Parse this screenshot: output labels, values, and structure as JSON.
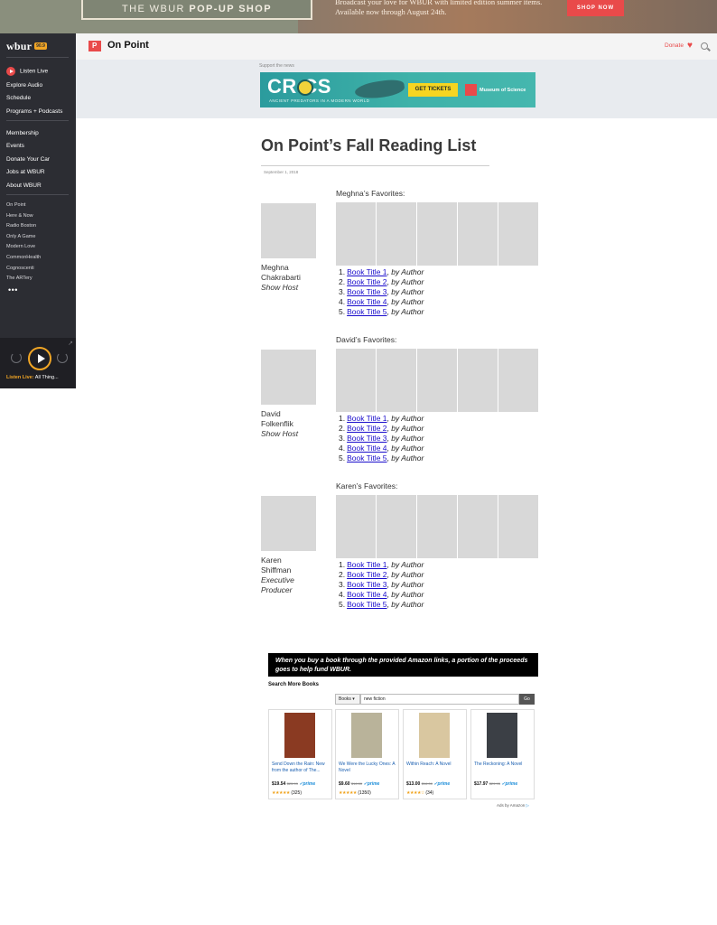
{
  "promo": {
    "shop_prefix": "THE WBUR",
    "shop_bold": "POP-UP SHOP",
    "copy": "Broadcast your love for WBUR with limited edition summer items. Available now through August 24th.",
    "button": "SHOP NOW"
  },
  "sidebar": {
    "logo": "wbur",
    "logo_badge": "90.9",
    "listen": "Listen Live",
    "main_items": [
      "Explore Audio",
      "Schedule",
      "Programs + Podcasts"
    ],
    "secondary_items": [
      "Membership",
      "Events",
      "Donate Your Car",
      "Jobs at WBUR",
      "About WBUR"
    ],
    "programs": [
      "On Point",
      "Here & Now",
      "Radio Boston",
      "Only A Game",
      "Modern Love",
      "CommonHealth",
      "Cognoscenti",
      "The ARTery"
    ],
    "more": "•••",
    "player_label_key": "Listen Live:",
    "player_label_val": "All Thing..."
  },
  "header": {
    "program": "On Point",
    "donate": "Donate",
    "heart": "♥"
  },
  "ad": {
    "support": "Support the news",
    "headline": "CR  CS",
    "tagline": "ANCIENT PREDATORS IN A MODERN WORLD",
    "button": "GET TICKETS",
    "sponsor": "Museum of Science"
  },
  "article": {
    "title": "On Point’s Fall Reading List",
    "date": "September 1, 2018"
  },
  "favorites": [
    {
      "label": "Meghna’s Favorites:",
      "name_line1": "Meghna",
      "name_line2": "Chakrabarti",
      "role_line1": "Show Host",
      "role_line2": "",
      "books": [
        {
          "num": "1.",
          "title": "Book Title 1",
          "author": "by Author"
        },
        {
          "num": "2.",
          "title": "Book Title 2",
          "author": "by Author"
        },
        {
          "num": "3.",
          "title": "Book Title 3",
          "author": "by Author"
        },
        {
          "num": "4.",
          "title": "Book Title 4",
          "author": "by Author"
        },
        {
          "num": "5.",
          "title": "Book Title 5",
          "author": "by Author"
        }
      ]
    },
    {
      "label": "David’s Favorites:",
      "name_line1": "David",
      "name_line2": "Folkenflik",
      "role_line1": "Show Host",
      "role_line2": "",
      "books": [
        {
          "num": "1.",
          "title": "Book Title 1",
          "author": "by Author"
        },
        {
          "num": "2.",
          "title": "Book Title 2",
          "author": "by Author"
        },
        {
          "num": "3.",
          "title": "Book Title 3",
          "author": "by Author"
        },
        {
          "num": "4.",
          "title": "Book Title 4",
          "author": "by Author"
        },
        {
          "num": "5.",
          "title": "Book Title 5",
          "author": "by Author"
        }
      ]
    },
    {
      "label": "Karen’s Favorites:",
      "name_line1": "Karen",
      "name_line2": "Shiffman",
      "role_line1": "Executive",
      "role_line2": "Producer",
      "books": [
        {
          "num": "1.",
          "title": "Book Title 1",
          "author": "by Author"
        },
        {
          "num": "2.",
          "title": "Book Title 2",
          "author": "by Author"
        },
        {
          "num": "3.",
          "title": "Book Title 3",
          "author": "by Author"
        },
        {
          "num": "4.",
          "title": "Book Title 4",
          "author": "by Author"
        },
        {
          "num": "5.",
          "title": "Book Title 5",
          "author": "by Author"
        }
      ]
    }
  ],
  "amazon": {
    "notice": "When you buy a book through the provided Amazon links, a portion of the proceeds goes to help fund WBUR.",
    "search_title": "Search More Books",
    "category": "Books ▾",
    "query": "new fiction",
    "go": "Go",
    "footer": "Ads by Amazon",
    "products": [
      {
        "name": "Send Down the Rain: New from the author of The...",
        "price": "$19.54",
        "list": "$25.99",
        "prime": "✓prime",
        "stars": "★★★★★",
        "reviews": "(325)",
        "cover_color": "#8a3a22"
      },
      {
        "name": "We Were the Lucky Ones: A Novel",
        "price": "$9.60",
        "list": "$16.00",
        "prime": "✓prime",
        "stars": "★★★★★",
        "reviews": "(1350)",
        "cover_color": "#b9b39a"
      },
      {
        "name": "Within Reach: A Novel",
        "price": "$13.00",
        "list": "$16.00",
        "prime": "✓prime",
        "stars": "★★★★☆",
        "reviews": "(34)",
        "cover_color": "#d9c7a0"
      },
      {
        "name": "The Reckoning: A Novel",
        "price": "$17.97",
        "list": "$29.95",
        "prime": "✓prime",
        "stars": "",
        "reviews": "",
        "cover_color": "#3b3f45"
      }
    ]
  }
}
